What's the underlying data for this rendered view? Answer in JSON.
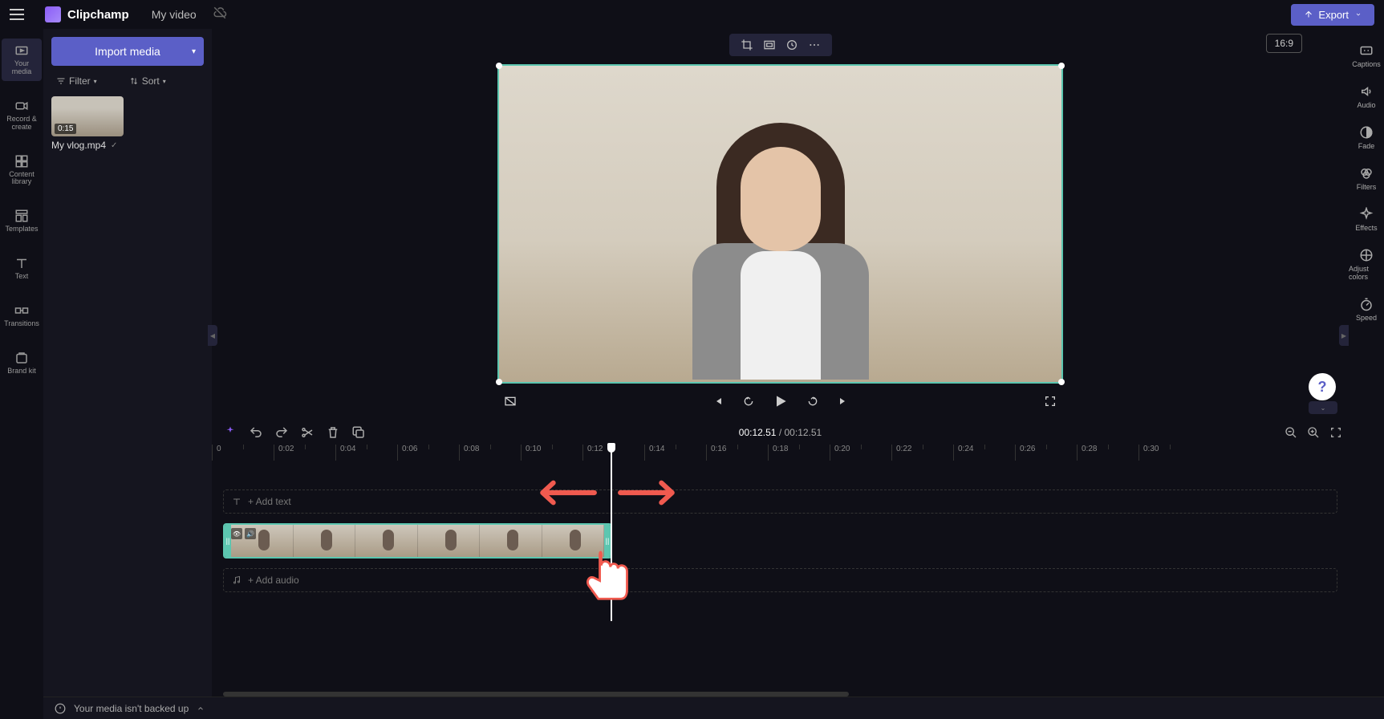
{
  "app": {
    "name": "Clipchamp",
    "video_title": "My video",
    "export_label": "Export"
  },
  "left_rail": {
    "items": [
      {
        "label": "Your media"
      },
      {
        "label": "Record & create"
      },
      {
        "label": "Content library"
      },
      {
        "label": "Templates"
      },
      {
        "label": "Text"
      },
      {
        "label": "Transitions"
      },
      {
        "label": "Brand kit"
      }
    ]
  },
  "media_panel": {
    "import_label": "Import media",
    "filter_label": "Filter",
    "sort_label": "Sort",
    "clip_duration": "0:15",
    "clip_name": "My vlog.mp4"
  },
  "right_rail": {
    "items": [
      {
        "label": "Captions"
      },
      {
        "label": "Audio"
      },
      {
        "label": "Fade"
      },
      {
        "label": "Filters"
      },
      {
        "label": "Effects"
      },
      {
        "label": "Adjust colors"
      },
      {
        "label": "Speed"
      }
    ]
  },
  "preview": {
    "aspect_ratio": "16:9"
  },
  "timeline": {
    "current_time": "00:12.51",
    "total_time": "00:12.51",
    "ruler_ticks": [
      "0",
      "0:02",
      "0:04",
      "0:06",
      "0:08",
      "0:10",
      "0:12",
      "0:14",
      "0:16",
      "0:18",
      "0:20",
      "0:22",
      "0:24",
      "0:26",
      "0:28",
      "0:30"
    ],
    "add_text_label": " + Add text",
    "add_audio_label": " + Add audio"
  },
  "footer": {
    "notice": "Your media isn't backed up"
  }
}
